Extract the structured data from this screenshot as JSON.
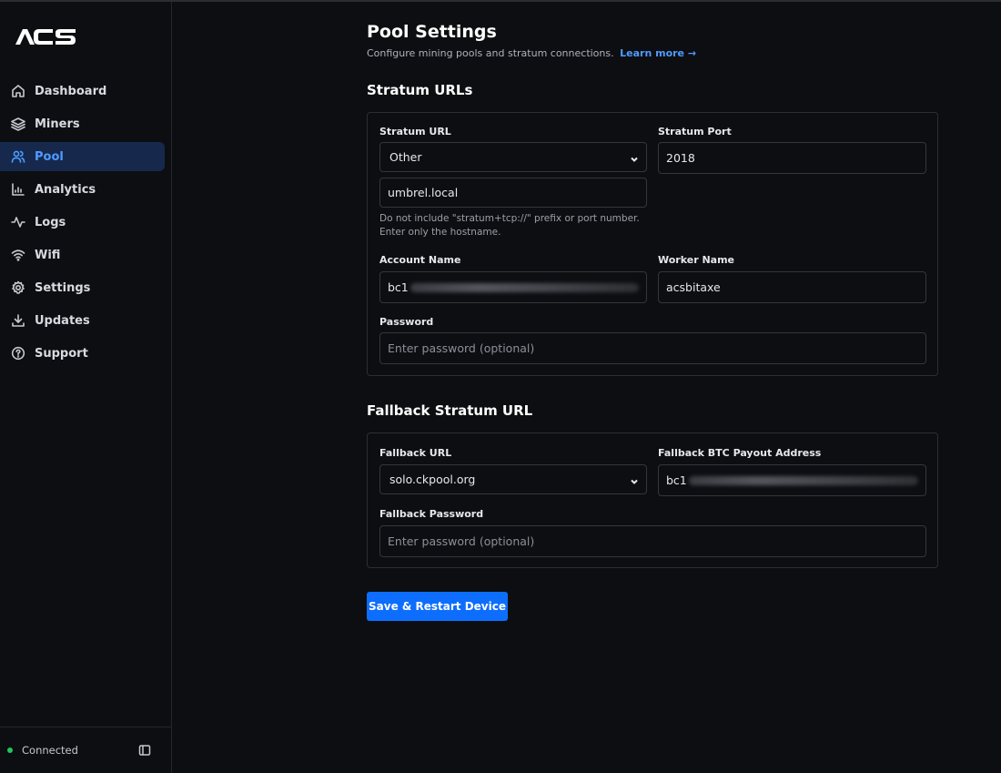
{
  "app": {
    "logo_text": "ACS",
    "brand_color": "#ffffff",
    "accent_color": "#4f9bff",
    "primary_button_color": "#0d6efd",
    "status_color": "#22c55e"
  },
  "sidebar": {
    "items": [
      {
        "label": "Dashboard",
        "icon": "home-icon",
        "active": false
      },
      {
        "label": "Miners",
        "icon": "layers-icon",
        "active": false
      },
      {
        "label": "Pool",
        "icon": "users-icon",
        "active": true
      },
      {
        "label": "Analytics",
        "icon": "chart-icon",
        "active": false
      },
      {
        "label": "Logs",
        "icon": "activity-icon",
        "active": false
      },
      {
        "label": "Wifi",
        "icon": "wifi-icon",
        "active": false
      },
      {
        "label": "Settings",
        "icon": "gear-icon",
        "active": false
      },
      {
        "label": "Updates",
        "icon": "download-icon",
        "active": false
      },
      {
        "label": "Support",
        "icon": "help-circle-icon",
        "active": false
      }
    ],
    "footer": {
      "status_text": "Connected",
      "collapse_icon": "sidebar-toggle-icon"
    }
  },
  "page": {
    "title": "Pool Settings",
    "subtitle": "Configure mining pools and stratum connections.",
    "learn_more": "Learn more →"
  },
  "stratum": {
    "section_title": "Stratum URLs",
    "url_label": "Stratum URL",
    "url_selected": "Other",
    "port_label": "Stratum Port",
    "port_value": "2018",
    "host_value": "umbrel.local",
    "hint_line1": "Do not include \"stratum+tcp://\" prefix or port number.",
    "hint_line2": "Enter only the hostname.",
    "account_label": "Account Name",
    "account_value": "bc1",
    "worker_label": "Worker Name",
    "worker_value": "acsbitaxe",
    "password_label": "Password",
    "password_placeholder": "Enter password (optional)"
  },
  "fallback": {
    "section_title": "Fallback Stratum URL",
    "url_label": "Fallback URL",
    "url_selected": "solo.ckpool.org",
    "address_label": "Fallback BTC Payout Address",
    "address_value": "bc1",
    "password_label": "Fallback Password",
    "password_placeholder": "Enter password (optional)"
  },
  "actions": {
    "save_label": "Save & Restart Device"
  }
}
